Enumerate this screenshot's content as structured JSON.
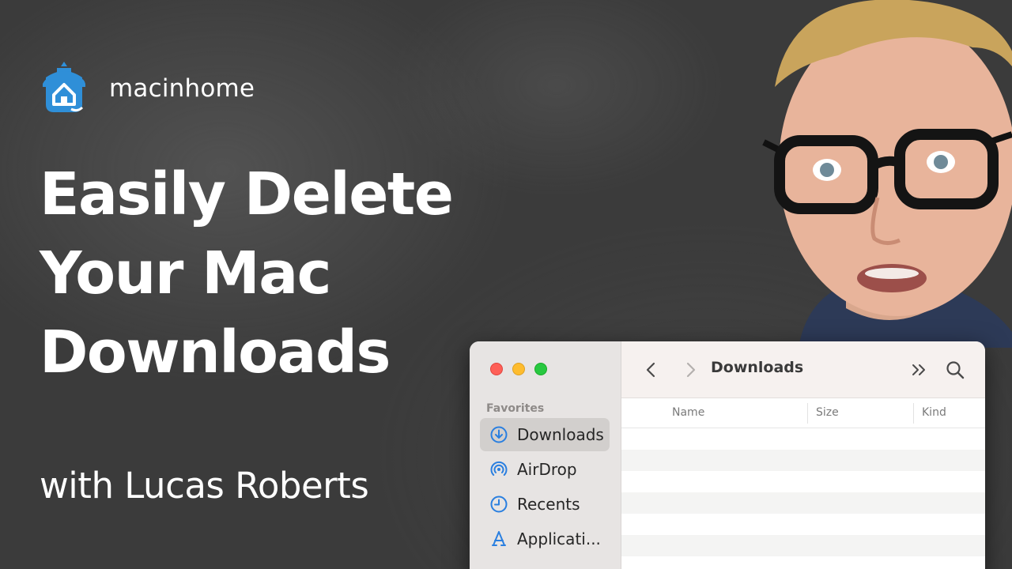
{
  "brand": {
    "name": "macinhome",
    "logo_icon": "house-logo-icon",
    "logo_color": "#2f8fd8"
  },
  "headline": {
    "line1": "Easily Delete",
    "line2": "Your Mac",
    "line3": "Downloads"
  },
  "byline": "with Lucas Roberts",
  "finder": {
    "title": "Downloads",
    "sidebar": {
      "section_label": "Favorites",
      "items": [
        {
          "label": "Downloads",
          "icon": "download-circle-icon",
          "active": true
        },
        {
          "label": "AirDrop",
          "icon": "airdrop-icon",
          "active": false
        },
        {
          "label": "Recents",
          "icon": "clock-icon",
          "active": false
        },
        {
          "label": "Applicati...",
          "icon": "applications-icon",
          "active": false
        }
      ]
    },
    "columns": {
      "name": "Name",
      "size": "Size",
      "kind": "Kind"
    },
    "accent_color": "#2a7fe0"
  }
}
